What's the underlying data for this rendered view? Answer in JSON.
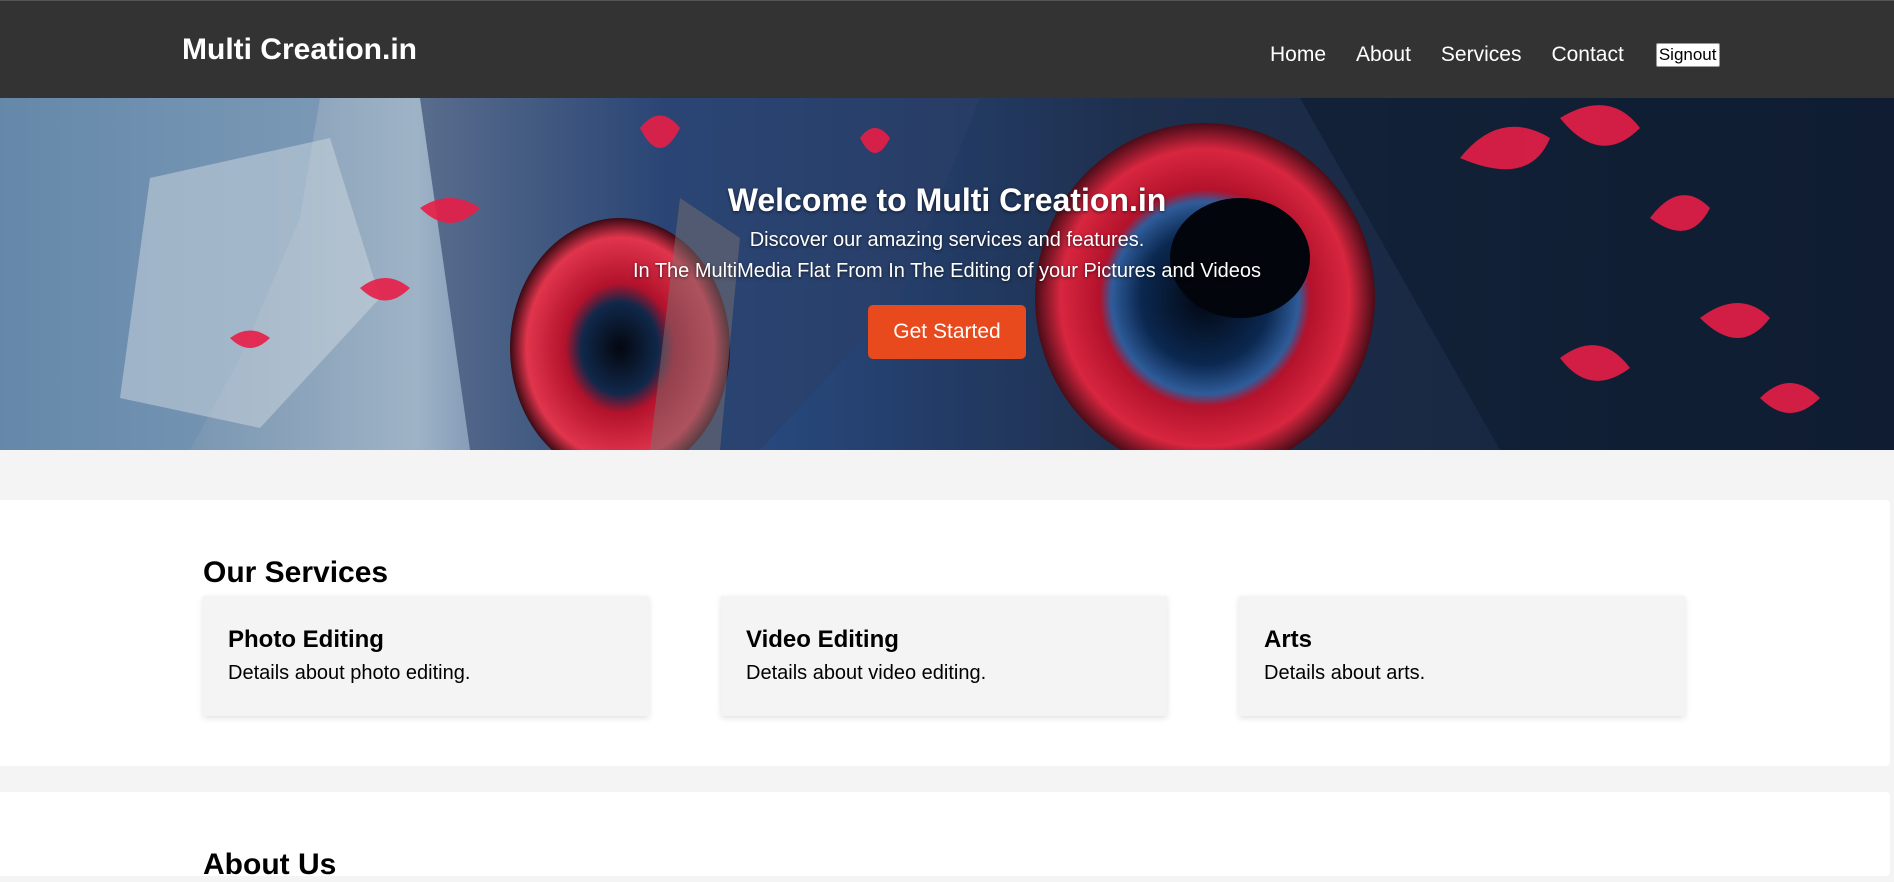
{
  "header": {
    "logo": "Multi Creation.in",
    "nav": [
      "Home",
      "About",
      "Services",
      "Contact"
    ],
    "signout_label": "Signout"
  },
  "hero": {
    "title": "Welcome to Multi Creation.in",
    "line1": "Discover our amazing services and features.",
    "line2": "In The MultiMedia Flat From In The Editing of your Pictures and Videos",
    "cta_label": "Get Started",
    "background_icon": "owl-eyes-artwork"
  },
  "services": {
    "title": "Our Services",
    "cards": [
      {
        "title": "Photo Editing",
        "desc": "Details about photo editing."
      },
      {
        "title": "Video Editing",
        "desc": "Details about video editing."
      },
      {
        "title": "Arts",
        "desc": "Details about arts."
      }
    ]
  },
  "about": {
    "title": "About Us"
  },
  "colors": {
    "header_bg": "#333333",
    "accent": "#e8491d",
    "page_bg": "#f4f4f4"
  }
}
